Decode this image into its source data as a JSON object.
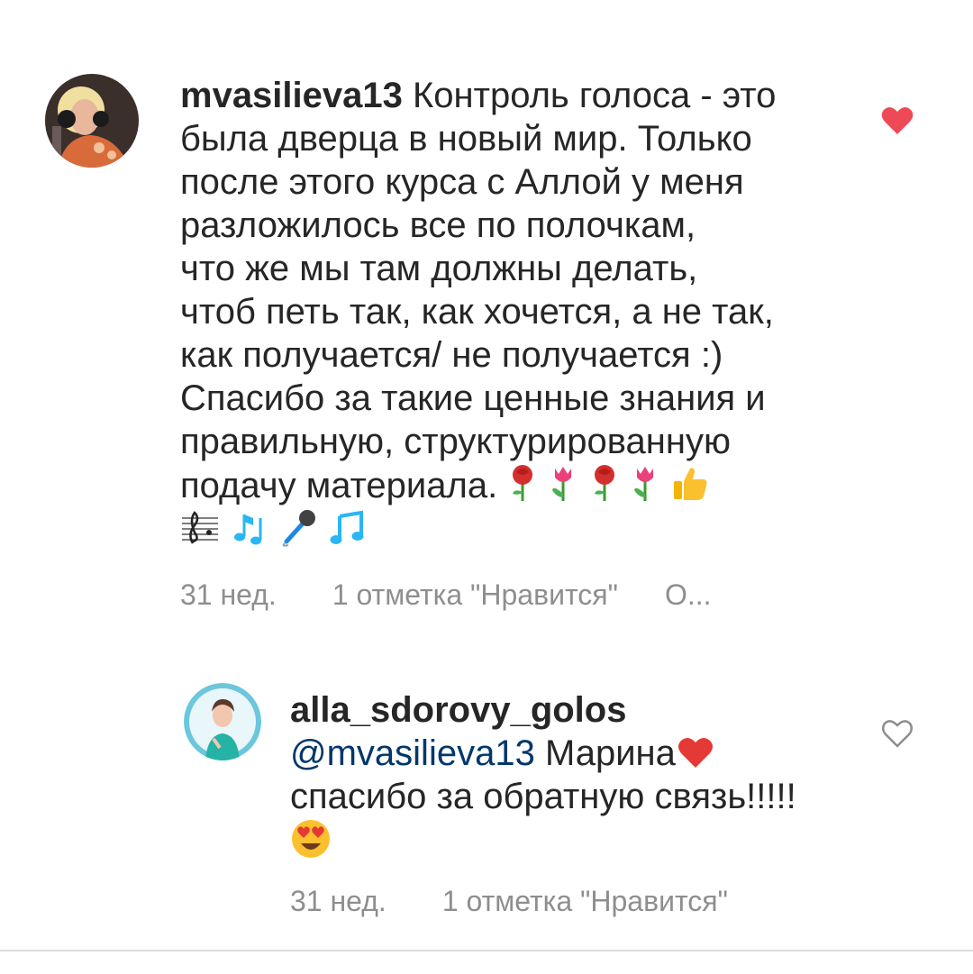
{
  "comments": [
    {
      "username": "mvasilieva13",
      "lines": [
        "Контроль голоса - это",
        "была дверца в новый мир. Только",
        "после этого курса с Аллой у меня",
        "разложилось все по полочкам,",
        "что же мы там должны делать,",
        "чтоб петь так, как хочется, а не так,",
        "как  получается/ не получается :)",
        "Спасибо за такие ценные знания и",
        "правильную, структурированную",
        "подачу материала."
      ],
      "emojis_line10": [
        "rose",
        "tulip",
        "rose",
        "tulip",
        "thumbs-up"
      ],
      "emojis_line11": [
        "musical-score",
        "musical-notes",
        "microphone",
        "musical-note"
      ],
      "time": "31 нед.",
      "likes": "1 отметка \"Нравится\"",
      "more": "О...",
      "liked": true,
      "like_color": "#ed4956"
    },
    {
      "username": "alla_sdorovy_golos",
      "mention": "@mvasilieva13",
      "text_after_mention": "Марина",
      "line2": "спасибо за обратную связь!!!!!",
      "emojis": [
        "red-heart",
        "heart-eyes-face"
      ],
      "time": "31 нед.",
      "likes": "1 отметка \"Нравится\"",
      "liked": false
    }
  ]
}
